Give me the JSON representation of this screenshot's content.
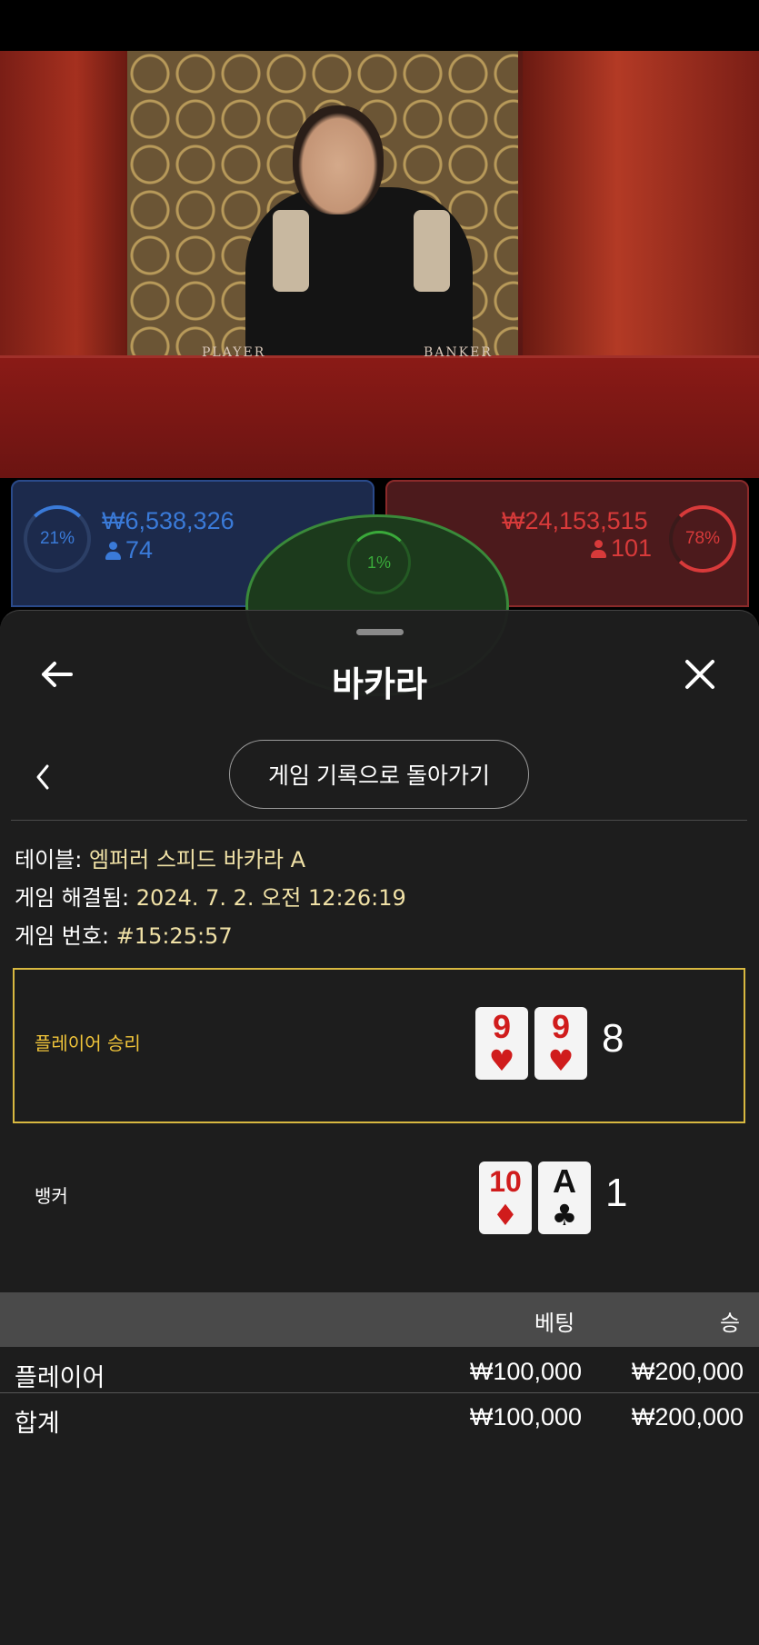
{
  "video": {
    "felt_player_label": "PLAYER",
    "felt_banker_label": "BANKER"
  },
  "stats": {
    "player": {
      "percent": "21%",
      "amount": "₩6,538,326",
      "count": "74"
    },
    "tie": {
      "percent": "1%"
    },
    "banker": {
      "percent": "78%",
      "amount": "₩24,153,515",
      "count": "101"
    }
  },
  "sheet": {
    "title": "바카라",
    "history_button": "게임 기록으로 돌아가기",
    "info": {
      "table_label": "테이블:",
      "table_value": "엠퍼러 스피드 바카라 A",
      "resolved_label": "게임 해결됨:",
      "resolved_value": "2024. 7. 2. 오전 12:26:19",
      "game_no_label": "게임 번호:",
      "game_no_value": "#15:25:57"
    },
    "result": {
      "winner_label": "플레이어 승리",
      "player_cards": [
        {
          "rank": "9",
          "suit": "♥",
          "color": "#d01c1c"
        },
        {
          "rank": "9",
          "suit": "♥",
          "color": "#d01c1c"
        }
      ],
      "player_score": "8",
      "banker_label": "뱅커",
      "banker_cards": [
        {
          "rank": "10",
          "suit": "♦",
          "color": "#d01c1c"
        },
        {
          "rank": "A",
          "suit": "♣",
          "color": "#111111"
        }
      ],
      "banker_score": "1"
    },
    "bets_table": {
      "headers": {
        "bet": "베팅",
        "win": "승"
      },
      "rows": [
        {
          "label": "플레이어",
          "bet": "₩100,000",
          "win": "₩200,000"
        }
      ],
      "total": {
        "label": "합계",
        "bet": "₩100,000",
        "win": "₩200,000"
      }
    }
  },
  "colors": {
    "player_blue": "#3a7ad8",
    "banker_red": "#d83a3a",
    "tie_green": "#3aaa3a",
    "winner_gold": "#f0c43a",
    "info_value": "#f0e1a6"
  }
}
